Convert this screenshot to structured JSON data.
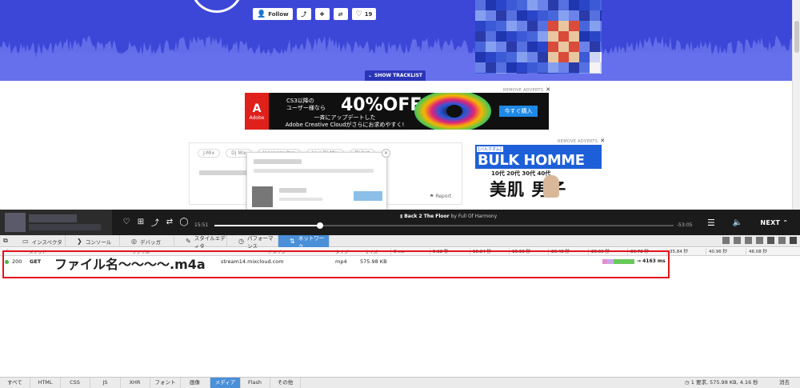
{
  "hero": {
    "follow_label": "Follow",
    "favorite_count": "19",
    "show_tracklist": "SHOW TRACKLIST",
    "colors": {
      "background": "#3c47d8",
      "accent": "#2a35b8"
    }
  },
  "ads": {
    "remove_label": "REMOVE ADVERTS",
    "close_glyph": "✕",
    "adobe": {
      "logo": "Adobe",
      "line1": "CS3以降の",
      "line2": "ユーザー様なら",
      "headline": "40%OFF",
      "line3": "一斉にアップデートした",
      "line4": "Adobe Creative Cloudがさらにお求めやすく!",
      "button": "今すぐ購入"
    },
    "bulk": {
      "tag": "[バルクオム]",
      "title": "BULK HOMME",
      "sub": "10代 20代 30代 40代",
      "kanji": "美肌 男子"
    }
  },
  "card": {
    "tags": [
      "J-Mix",
      "Dj Mix",
      "Japanese Pop",
      "Live Dj Mix",
      "Dj Set"
    ],
    "report": "Report"
  },
  "player": {
    "elapsed": "15:51",
    "remaining": "-53:05",
    "progress": 0.23,
    "track_title": "Back 2 The Floor",
    "track_artist": "by Full Of Harmony",
    "next": "NEXT"
  },
  "devtools": {
    "tabs": [
      {
        "label": "インスペクタ",
        "icon": "inspector-icon"
      },
      {
        "label": "コンソール",
        "icon": "console-icon"
      },
      {
        "label": "デバッガ",
        "icon": "debugger-icon"
      },
      {
        "label": "スタイルエディタ",
        "icon": "style-editor-icon"
      },
      {
        "label": "パフォーマンス",
        "icon": "performance-icon"
      },
      {
        "label": "ネットワーク",
        "icon": "network-icon",
        "active": true
      }
    ],
    "columns": {
      "check": "✓",
      "method": "メソッド",
      "file": "ファイル",
      "domain": "ドメイン",
      "type": "タイプ",
      "size": "サイズ"
    },
    "timeline": [
      "0 ms",
      "5.12 秒",
      "10.24 秒",
      "15.36 秒",
      "20.48 秒",
      "25.60 秒",
      "30.72 秒",
      "35.84 秒",
      "40.96 秒",
      "46.08 秒"
    ],
    "rows": [
      {
        "status": "200",
        "method": "GET",
        "file": "ファイル名～～～～.m4a",
        "domain": "stream14.mixcloud.com",
        "type": "mp4",
        "size": "575.98 KB",
        "time": "→ 4163 ms"
      }
    ],
    "filters": [
      "すべて",
      "HTML",
      "CSS",
      "JS",
      "XHR",
      "フォント",
      "画像",
      "メディア",
      "Flash",
      "その他"
    ],
    "active_filter": "メディア",
    "summary": "1 要求, 575.98 KB, 4.16 秒",
    "clear": "消去"
  }
}
